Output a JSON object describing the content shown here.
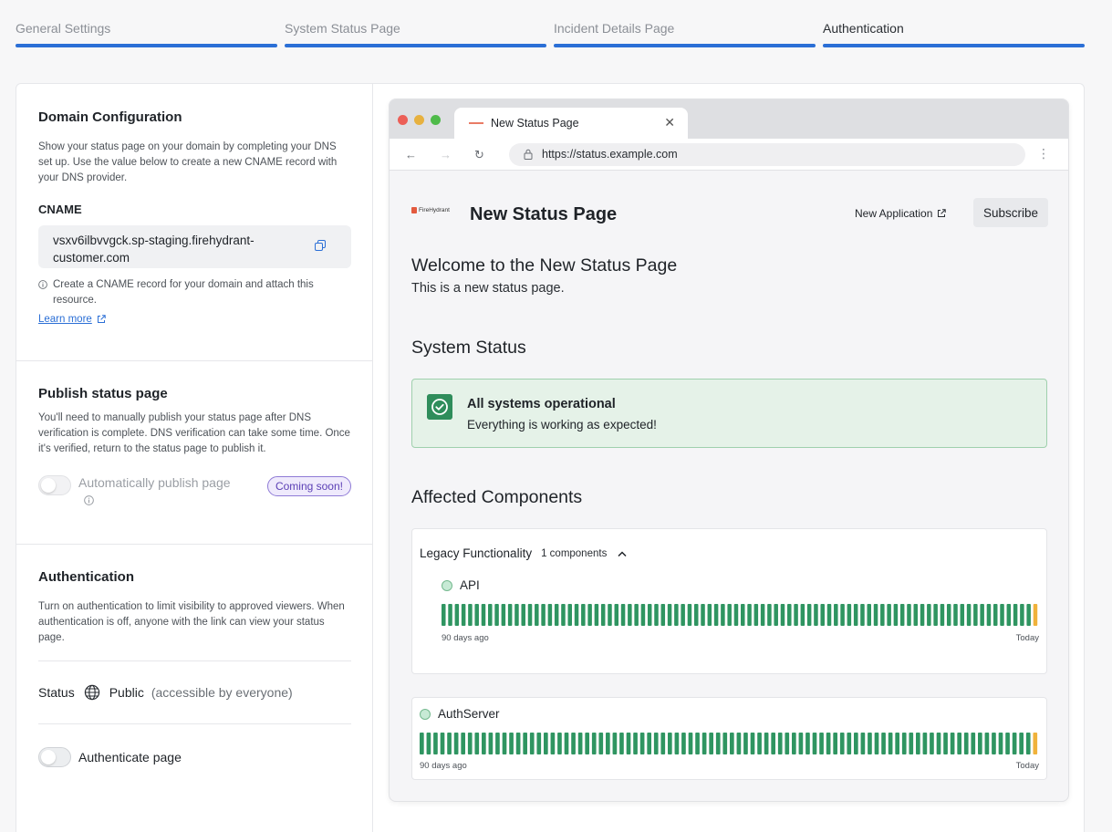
{
  "steps": [
    {
      "label": "General Settings"
    },
    {
      "label": "System Status Page"
    },
    {
      "label": "Incident Details Page"
    },
    {
      "label": "Authentication"
    }
  ],
  "domain": {
    "title": "Domain Configuration",
    "description": "Show your status page on your domain by completing your DNS set up. Use the value below to create a new CNAME record with your DNS provider.",
    "cname_label": "CNAME",
    "cname_value": "vsxv6ilbvvgck.sp-staging.firehydrant-customer.com",
    "hint": "Create a CNAME record for your domain and attach this resource.",
    "learn_more": "Learn more"
  },
  "publish": {
    "title": "Publish status page",
    "description": "You'll need to manually publish your status page after DNS verification is complete. DNS verification can take some time. Once it's verified, return to the status page to publish it.",
    "auto_label": "Automatically publish page",
    "badge": "Coming soon!"
  },
  "auth": {
    "title": "Authentication",
    "description": "Turn on authentication to limit visibility to approved viewers. When authentication is off, anyone with the link can view your status page.",
    "status_label": "Status",
    "status_value": "Public",
    "status_note": "(accessible by everyone)",
    "toggle_label": "Authenticate page"
  },
  "browser": {
    "tab_title": "New Status Page",
    "url": "https://status.example.com"
  },
  "status_page": {
    "logo_text": "FireHydrant",
    "title": "New Status Page",
    "new_app_link": "New Application",
    "subscribe": "Subscribe",
    "welcome_heading": "Welcome to the New Status Page",
    "welcome_text": "This is a new status page.",
    "system_status_heading": "System Status",
    "ok_title": "All systems operational",
    "ok_text": "Everything is working as expected!",
    "affected_heading": "Affected Components",
    "group_name": "Legacy Functionality",
    "group_count": "1 components",
    "components": [
      {
        "name": "API",
        "range_start": "90 days ago",
        "range_end": "Today",
        "days": 90,
        "warn_days": 1
      },
      {
        "name": "AuthServer",
        "range_start": "90 days ago",
        "range_end": "Today",
        "days": 90,
        "warn_days": 1
      }
    ]
  },
  "colors": {
    "accent": "#2b6fd6",
    "ok_green": "#2f8d5b",
    "bar_green": "#2f9561",
    "bar_warn": "#f0b23b"
  }
}
